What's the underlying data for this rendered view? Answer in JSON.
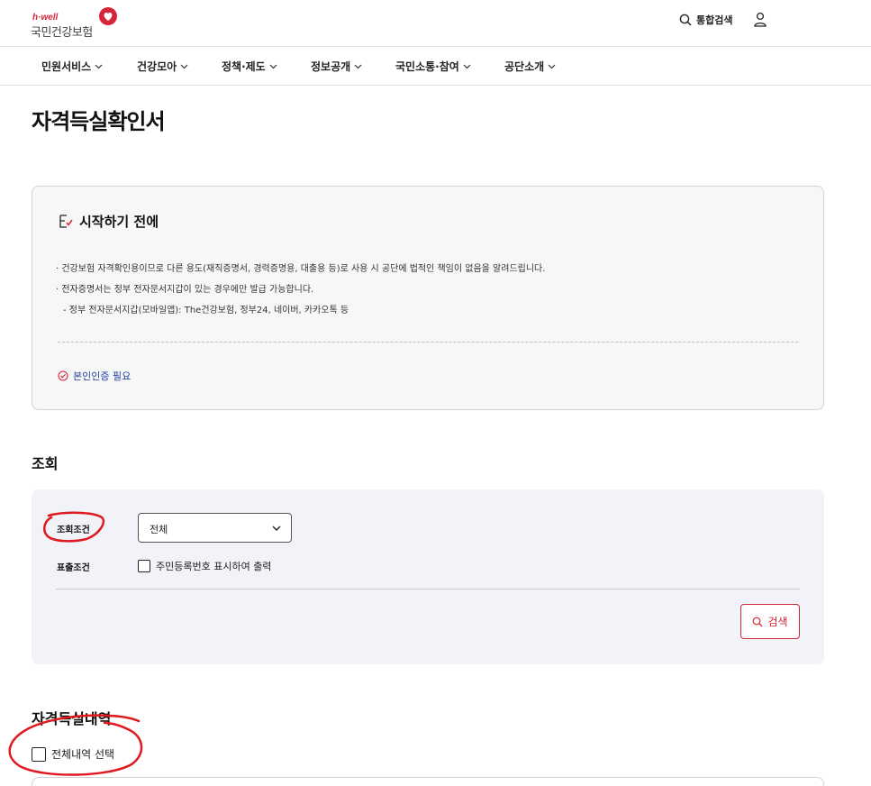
{
  "header": {
    "logo_small": "h·well",
    "logo_main": "국민건강보험",
    "search_label": "통합검색"
  },
  "nav": {
    "items": [
      {
        "label": "민원서비스"
      },
      {
        "label": "건강모아"
      },
      {
        "label": "정책·제도"
      },
      {
        "label": "정보공개"
      },
      {
        "label": "국민소통·참여"
      },
      {
        "label": "공단소개"
      }
    ]
  },
  "page": {
    "title": "자격득실확인서"
  },
  "notice": {
    "title": "시작하기 전에",
    "items": [
      "· 건강보험 자격확인용이므로 다른 용도(재직증명서, 경력증명용, 대출용 등)로 사용 시 공단에 법적인 책임이 없음을 알려드립니다.",
      "· 전자증명서는 정부 전자문서지갑이 있는 경우에만 발급 가능합니다.",
      "  - 정부 전자문서지갑(모바일앱): The건강보험, 정부24, 네이버, 카카오톡 등"
    ],
    "auth_label": "본인인증 필요"
  },
  "search": {
    "section_title": "조회",
    "condition_label": "조회조건",
    "condition_value": "전체",
    "output_label": "표출조건",
    "output_checkbox_label": "주민등록번호 표시하여 출력",
    "button_label": "검색"
  },
  "results": {
    "section_title": "자격득실내역",
    "select_all_label": "전체내역 선택"
  },
  "colors": {
    "brand_red": "#d6263a",
    "link_blue": "#1c3f9c",
    "panel_bg": "#f1f3f8",
    "notice_bg": "#f7f7f7",
    "annotation_red": "#e0191f"
  }
}
